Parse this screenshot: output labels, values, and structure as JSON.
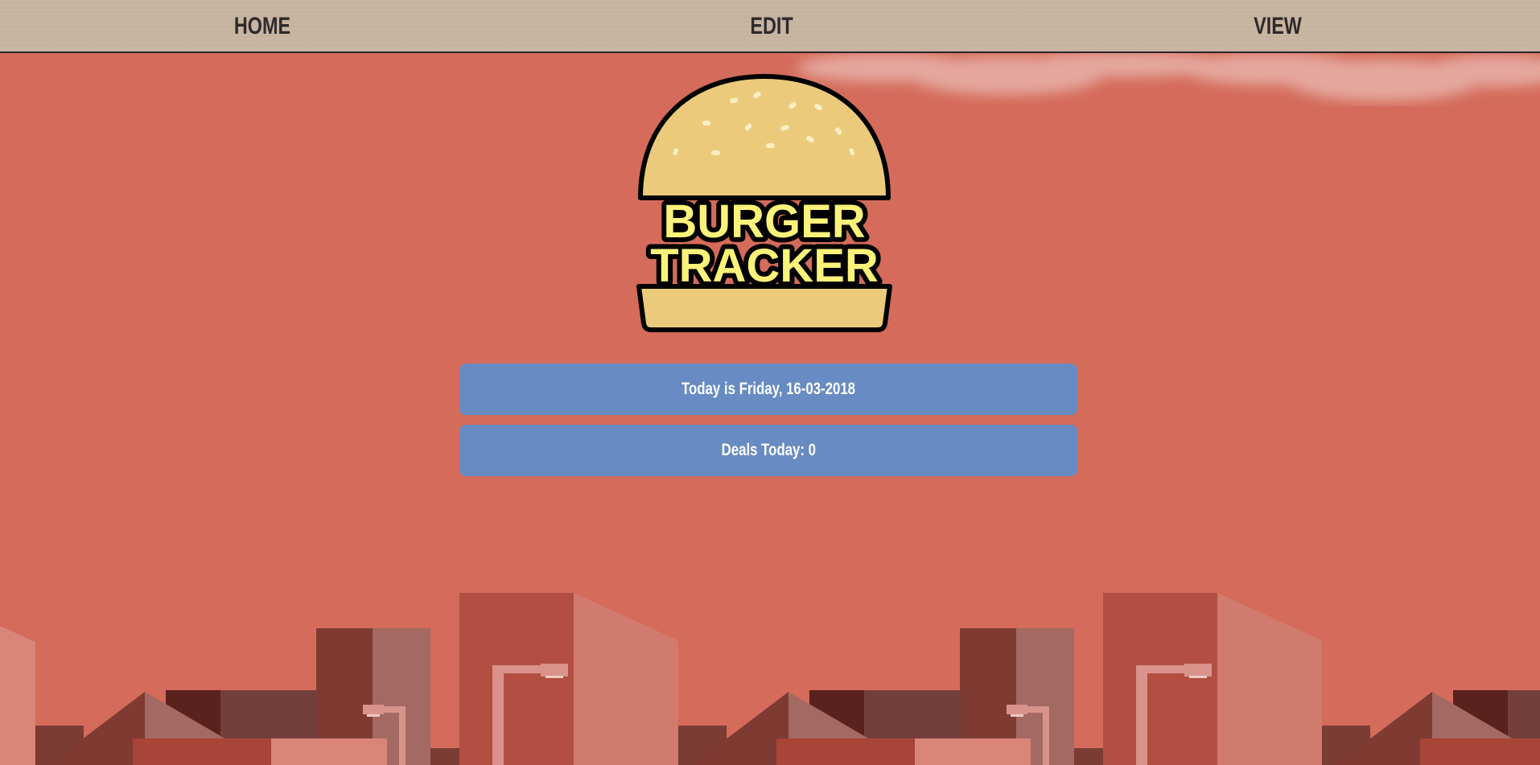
{
  "nav": {
    "home_label": "HOME",
    "edit_label": "EDIT",
    "view_label": "VIEW"
  },
  "logo": {
    "line1": "BURGER",
    "line2": "TRACKER"
  },
  "info": {
    "date_text": "Today is Friday, 16-03-2018",
    "deals_text": "Deals Today: 0"
  },
  "colors": {
    "background": "#d46b5b",
    "navbar": "#c9b7a4",
    "panel": "#678bc2",
    "bun": "#ebcb7b",
    "logo_text": "#fbf27a"
  }
}
